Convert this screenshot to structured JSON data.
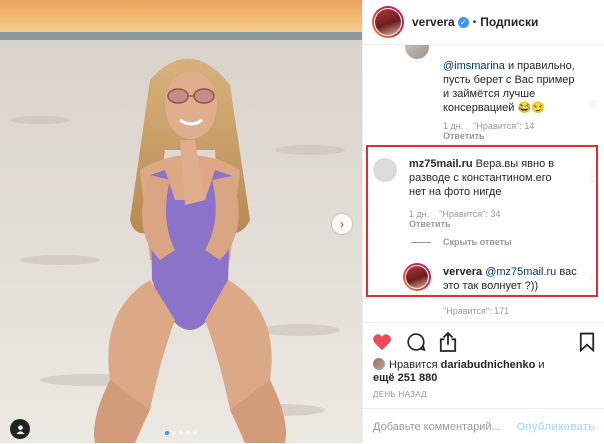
{
  "header": {
    "username": "ververa",
    "separator": "•",
    "follow_label": "Подписки"
  },
  "comments": [
    {
      "lines": [
        "@imsmarina и правильно,",
        "пусть берет с Вас пример",
        "и займётся лучше",
        "консервацией 😂😏"
      ],
      "mention": "@imsmarina",
      "time": "1 дн.",
      "likes": "\"Нравится\": 14",
      "reply": "Ответить"
    },
    {
      "username": "mz75mail.ru",
      "lines": [
        "Вера.вы явно в",
        "разводе с константином.его",
        "нет на фото нигде"
      ],
      "time": "1 дн.",
      "likes": "\"Нравится\": 34",
      "reply": "Ответить",
      "hide_replies": "Скрыть ответы"
    },
    {
      "username": "ververa",
      "mention": "@mz75mail.ru",
      "text_after": " вас",
      "line2": "это так волнует ?))",
      "likes": "\"Нравится\": 171"
    }
  ],
  "likes": {
    "prefix": "Нравится",
    "user": "dariabudnichenko",
    "and": "и",
    "more": "ещё 251 880"
  },
  "date": "ДЕНЬ НАЗАД",
  "add_comment": {
    "placeholder": "Добавьте комментарий...",
    "publish": "Опубликовать"
  },
  "icons": {
    "heart": "heart-icon",
    "comment": "comment-icon",
    "share": "share-icon",
    "bookmark": "bookmark-icon",
    "next": "chevron-right-icon",
    "user_tag": "user-tag-icon"
  },
  "colors": {
    "heart_active": "#ed4956",
    "link": "#003569",
    "verified": "#3897f0",
    "highlight": "#e03030"
  }
}
